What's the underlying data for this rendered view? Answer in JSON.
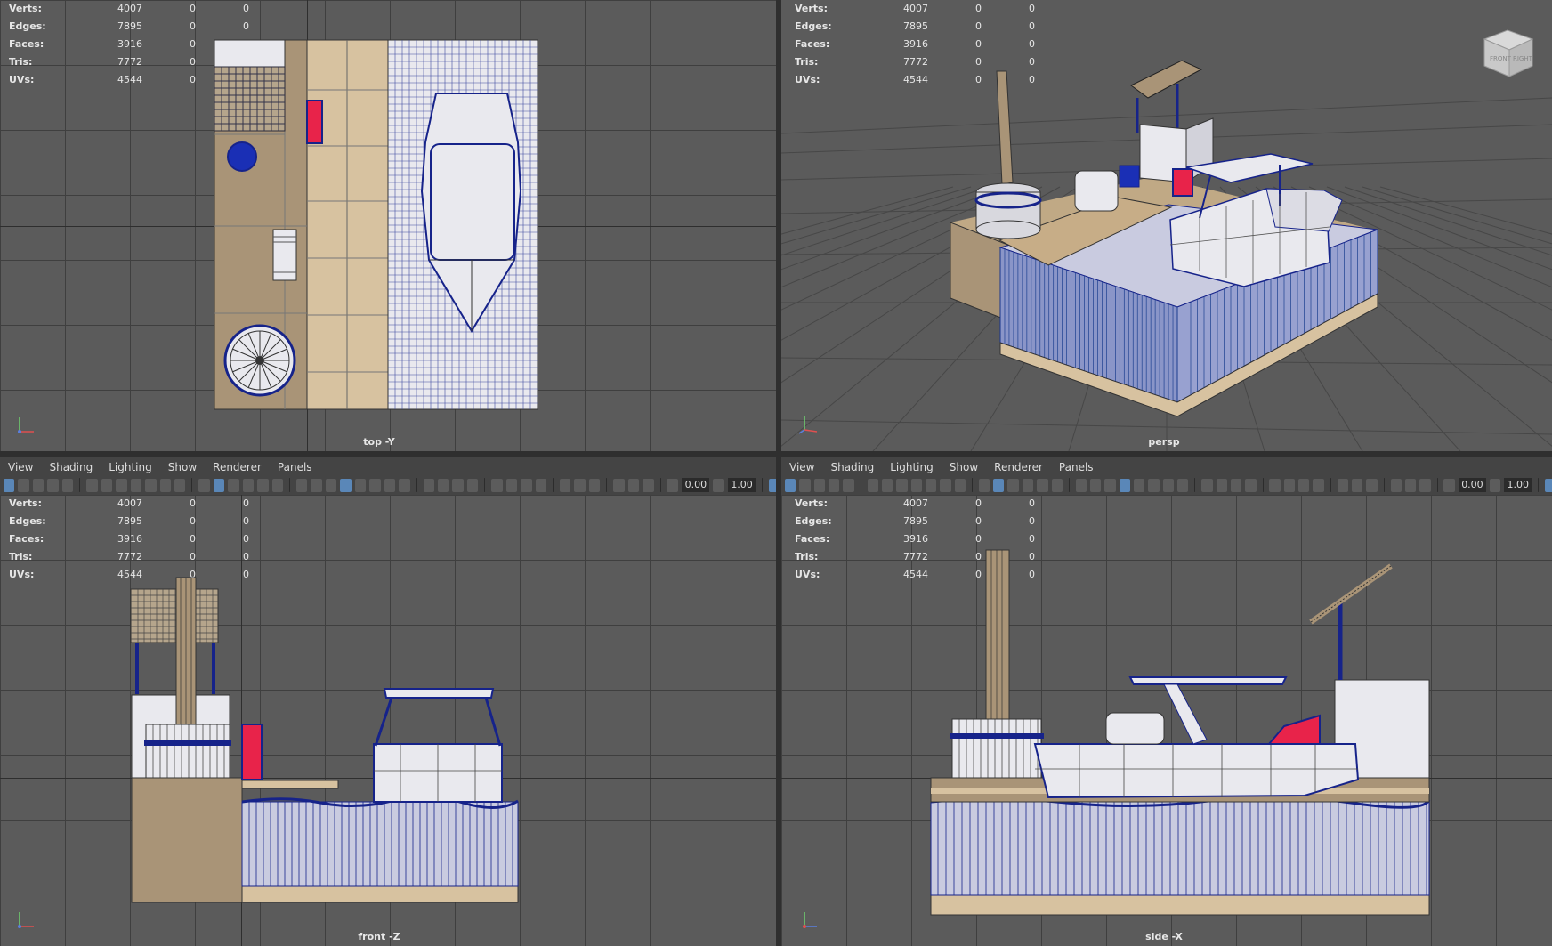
{
  "viewports": {
    "top": {
      "camera": "top -Y",
      "stats": [
        {
          "label": "Verts:",
          "v1": "4007",
          "v2": "0",
          "v3": "0"
        },
        {
          "label": "Edges:",
          "v1": "7895",
          "v2": "0",
          "v3": "0"
        },
        {
          "label": "Faces:",
          "v1": "3916",
          "v2": "0",
          "v3": "0"
        },
        {
          "label": "Tris:",
          "v1": "7772",
          "v2": "0",
          "v3": ""
        },
        {
          "label": "UVs:",
          "v1": "4544",
          "v2": "0",
          "v3": "0"
        }
      ]
    },
    "persp": {
      "camera": "persp",
      "stats": [
        {
          "label": "Verts:",
          "v1": "4007",
          "v2": "0",
          "v3": "0"
        },
        {
          "label": "Edges:",
          "v1": "7895",
          "v2": "0",
          "v3": "0"
        },
        {
          "label": "Faces:",
          "v1": "3916",
          "v2": "0",
          "v3": "0"
        },
        {
          "label": "Tris:",
          "v1": "7772",
          "v2": "0",
          "v3": "0"
        },
        {
          "label": "UVs:",
          "v1": "4544",
          "v2": "0",
          "v3": "0"
        }
      ],
      "navcube": {
        "front": "FRONT",
        "right": "RIGHT"
      }
    },
    "front": {
      "camera": "front -Z",
      "stats": [
        {
          "label": "Verts:",
          "v1": "4007",
          "v2": "0",
          "v3": "0"
        },
        {
          "label": "Edges:",
          "v1": "7895",
          "v2": "0",
          "v3": "0"
        },
        {
          "label": "Faces:",
          "v1": "3916",
          "v2": "0",
          "v3": "0"
        },
        {
          "label": "Tris:",
          "v1": "7772",
          "v2": "0",
          "v3": "0"
        },
        {
          "label": "UVs:",
          "v1": "4544",
          "v2": "0",
          "v3": "0"
        }
      ]
    },
    "side": {
      "camera": "side -X",
      "stats": [
        {
          "label": "Verts:",
          "v1": "4007",
          "v2": "0",
          "v3": "0"
        },
        {
          "label": "Edges:",
          "v1": "7895",
          "v2": "0",
          "v3": "0"
        },
        {
          "label": "Faces:",
          "v1": "3916",
          "v2": "0",
          "v3": "0"
        },
        {
          "label": "Tris:",
          "v1": "7772",
          "v2": "0",
          "v3": "0"
        },
        {
          "label": "UVs:",
          "v1": "4544",
          "v2": "0",
          "v3": "0"
        }
      ]
    }
  },
  "menus": [
    "View",
    "Shading",
    "Lighting",
    "Show",
    "Renderer",
    "Panels"
  ],
  "toolbar": {
    "exposure": "0.00",
    "gamma": "1.00"
  },
  "colors": {
    "sand": "#d7c2a0",
    "wood": "#a99477",
    "water": "#1c3f8f",
    "red": "#e8234a",
    "navy": "#16238a",
    "white": "#e9e9ee"
  }
}
